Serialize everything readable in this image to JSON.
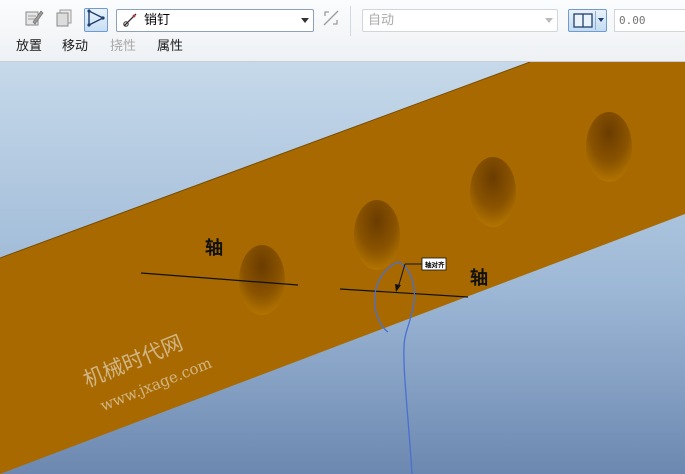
{
  "toolbar": {
    "tool_buttons": [
      {
        "icon": "edit-constraint-icon",
        "active": false
      },
      {
        "icon": "copy-icon",
        "active": false
      },
      {
        "icon": "pin-constraint-icon",
        "active": true
      }
    ],
    "constraint_type": "销钉",
    "constraint_type_icon": "pin-icon",
    "flip_icon": "flip-icon",
    "offset_mode": "自动",
    "offset_value_placeholder": "0.00"
  },
  "tabs": [
    {
      "label": "放置",
      "disabled": false
    },
    {
      "label": "移动",
      "disabled": false
    },
    {
      "label": "挠性",
      "disabled": true
    },
    {
      "label": "属性",
      "disabled": false
    }
  ],
  "viewport": {
    "axis_labels": [
      "轴",
      "轴"
    ],
    "callout_text": "轴对齐",
    "watermark_title": "机械时代网",
    "watermark_url": "www.jxage.com",
    "colors": {
      "background_top": "#c6d9ea",
      "background_bottom": "#6c88b0",
      "beam": "#a86a00",
      "hole": "#8c5200",
      "pin_curve": "#4a6fd0"
    }
  }
}
